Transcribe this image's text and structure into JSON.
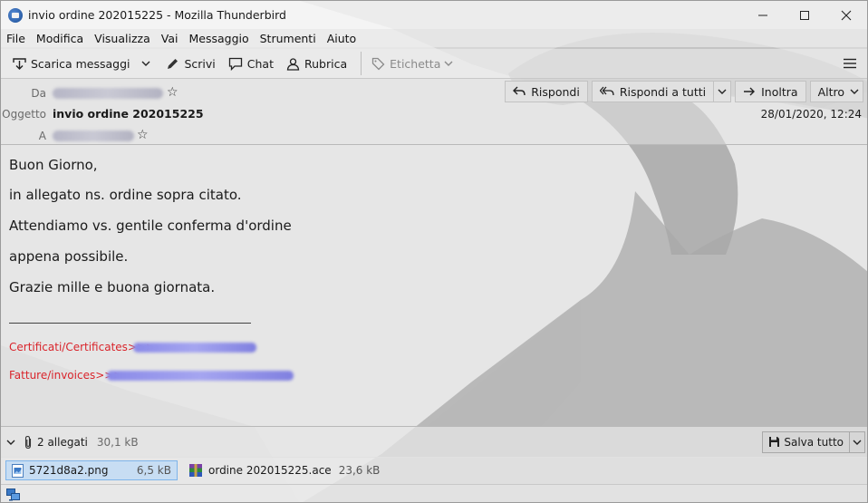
{
  "window": {
    "title": "invio ordine 202015225 - Mozilla Thunderbird",
    "controls": {
      "minimize": "─",
      "maximize": "☐",
      "close": "✕"
    }
  },
  "menu": [
    "File",
    "Modifica",
    "Visualizza",
    "Vai",
    "Messaggio",
    "Strumenti",
    "Aiuto"
  ],
  "toolbar": {
    "get_messages": "Scarica messaggi",
    "write": "Scrivi",
    "chat": "Chat",
    "address_book": "Rubrica",
    "tag": "Etichetta"
  },
  "header": {
    "from_label": "Da",
    "subject_label": "Oggetto",
    "subject": "invio ordine 202015225",
    "to_label": "A",
    "date": "28/01/2020, 12:24",
    "reply": "Rispondi",
    "reply_all": "Rispondi a tutti",
    "forward": "Inoltra",
    "more": "Altro"
  },
  "body": {
    "lines": [
      "Buon Giorno,",
      "in allegato ns. ordine sopra citato.",
      "Attendiamo vs. gentile conferma d'ordine",
      "appena possibile.",
      "Grazie mille e buona giornata."
    ],
    "cert_label": "Certificati/Certificates>>>",
    "invoice_label": "Fatture/invoices>>>"
  },
  "attachments": {
    "count": "2 allegati",
    "total_size": "30,1 kB",
    "save_all": "Salva tutto",
    "items": [
      {
        "name": "5721d8a2.png",
        "size": "6,5 kB",
        "icon": "image-file-icon"
      },
      {
        "name": "ordine 202015225.ace",
        "size": "23,6 kB",
        "icon": "archive-file-icon"
      }
    ]
  }
}
